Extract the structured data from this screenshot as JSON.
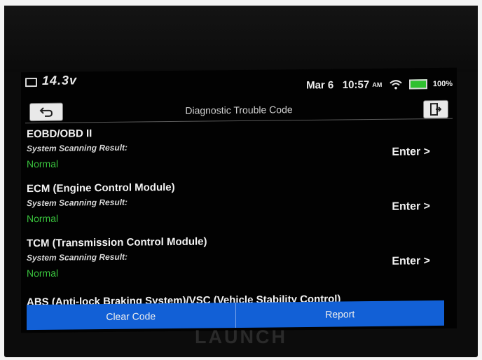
{
  "status_bar": {
    "voltage": "14.3v",
    "date": "Mar 6",
    "time": "10:57",
    "ampm": "AM",
    "battery_percent": "100%",
    "battery_level": 1.0,
    "icons": [
      "battery-icon",
      "wifi-icon"
    ]
  },
  "header": {
    "title": "Diagnostic Trouble Code",
    "back_icon": "back-arrow-icon",
    "exit_icon": "exit-icon"
  },
  "systems": [
    {
      "name": "EOBD/OBD II",
      "scan_label": "System Scanning Result:",
      "result": "Normal",
      "action": "Enter >"
    },
    {
      "name": "ECM (Engine Control Module)",
      "scan_label": "System Scanning Result:",
      "result": "Normal",
      "action": "Enter >"
    },
    {
      "name": "TCM (Transmission Control Module)",
      "scan_label": "System Scanning Result:",
      "result": "Normal",
      "action": "Enter >"
    },
    {
      "name": "ABS (Anti-lock Braking System)/VSC (Vehicle Stability Control)"
    }
  ],
  "footer": {
    "clear_code": "Clear Code",
    "report": "Report"
  },
  "brand": "LAUNCH",
  "colors": {
    "accent": "#1260d6",
    "result_ok": "#39c13d",
    "battery": "#2fc12f"
  }
}
